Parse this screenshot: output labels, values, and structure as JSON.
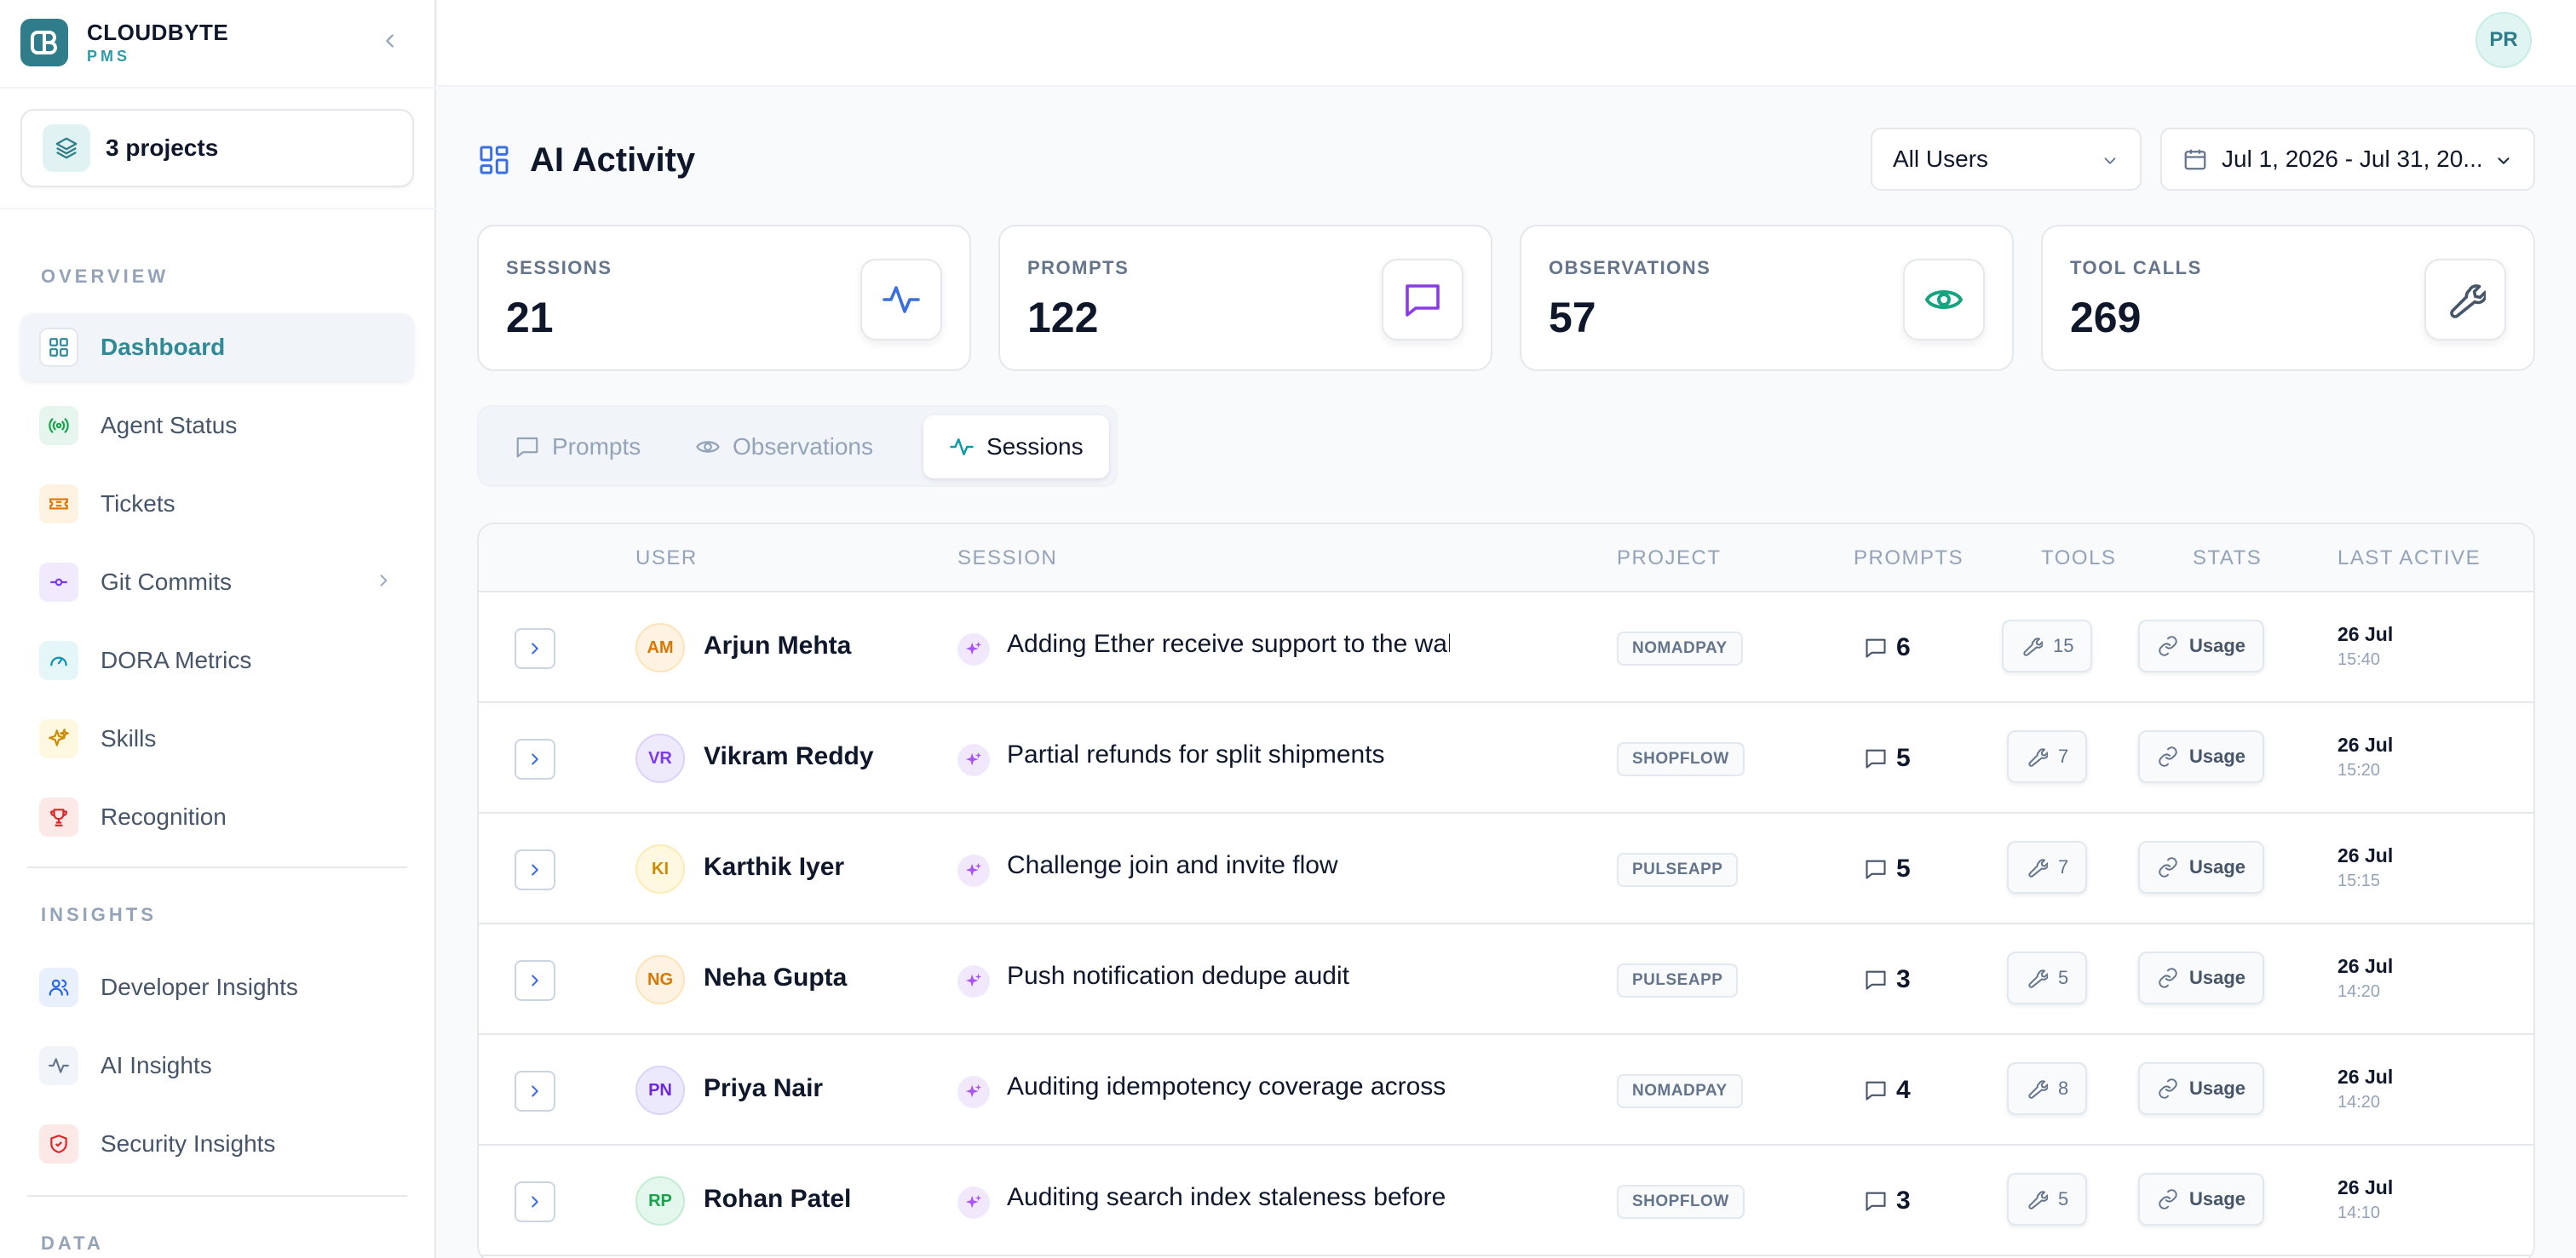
{
  "brand": {
    "name": "CLOUDBYTE",
    "sub": "PMS"
  },
  "projects": {
    "label": "3 projects"
  },
  "nav": {
    "overview_label": "OVERVIEW",
    "overview_items": [
      {
        "label": "Dashboard",
        "icon": "grid-icon",
        "active": true
      },
      {
        "label": "Agent Status",
        "icon": "broadcast-icon"
      },
      {
        "label": "Tickets",
        "icon": "ticket-icon"
      },
      {
        "label": "Git Commits",
        "icon": "git-commit-icon"
      },
      {
        "label": "DORA Metrics",
        "icon": "gauge-icon"
      },
      {
        "label": "Skills",
        "icon": "sparkles-icon"
      },
      {
        "label": "Recognition",
        "icon": "trophy-icon"
      }
    ],
    "insights_label": "INSIGHTS",
    "insights_items": [
      {
        "label": "Developer Insights",
        "icon": "users-icon"
      },
      {
        "label": "AI Insights",
        "icon": "activity-icon"
      },
      {
        "label": "Security Insights",
        "icon": "shield-icon"
      }
    ],
    "data_label": "DATA"
  },
  "user": {
    "initials": "PR"
  },
  "header": {
    "title": "AI Activity",
    "users_filter": "All Users",
    "date_range": "Jul 1, 2026 - Jul 31, 20..."
  },
  "stats": [
    {
      "label": "SESSIONS",
      "value": "21",
      "icon": "activity-icon",
      "color": "#3b6fe0"
    },
    {
      "label": "PROMPTS",
      "value": "122",
      "icon": "message-square-icon",
      "color": "#8b3ce0"
    },
    {
      "label": "OBSERVATIONS",
      "value": "57",
      "icon": "eye-icon",
      "color": "#16a37f"
    },
    {
      "label": "TOOL CALLS",
      "value": "269",
      "icon": "wrench-icon",
      "color": "#475569"
    }
  ],
  "tabs": [
    {
      "label": "Prompts",
      "icon": "message-square-icon"
    },
    {
      "label": "Observations",
      "icon": "eye-icon"
    },
    {
      "label": "Sessions",
      "icon": "activity-icon",
      "active": true
    }
  ],
  "table": {
    "headers": {
      "user": "USER",
      "session": "SESSION",
      "project": "PROJECT",
      "prompts": "PROMPTS",
      "tools": "TOOLS",
      "stats": "STATS",
      "last_active": "LAST ACTIVE"
    },
    "rows": [
      {
        "initials": "AM",
        "name": "Arjun Mehta",
        "session": "Adding Ether receive support to the walle",
        "project": "NOMADPAY",
        "prompts": "6",
        "tools": "15",
        "stats": "Usage",
        "date": "26 Jul",
        "time": "15:40",
        "avatar_bg": "#fef3e2",
        "avatar_fg": "#d97706"
      },
      {
        "initials": "VR",
        "name": "Vikram Reddy",
        "session": "Partial refunds for split shipments",
        "project": "SHOPFLOW",
        "prompts": "5",
        "tools": "7",
        "stats": "Usage",
        "date": "26 Jul",
        "time": "15:20",
        "avatar_bg": "#efe9fc",
        "avatar_fg": "#7c3aed"
      },
      {
        "initials": "KI",
        "name": "Karthik Iyer",
        "session": "Challenge join and invite flow",
        "project": "PULSEAPP",
        "prompts": "5",
        "tools": "7",
        "stats": "Usage",
        "date": "26 Jul",
        "time": "15:15",
        "avatar_bg": "#fef8e1",
        "avatar_fg": "#ca8a04"
      },
      {
        "initials": "NG",
        "name": "Neha Gupta",
        "session": "Push notification dedupe audit",
        "project": "PULSEAPP",
        "prompts": "3",
        "tools": "5",
        "stats": "Usage",
        "date": "26 Jul",
        "time": "14:20",
        "avatar_bg": "#fef3e2",
        "avatar_fg": "#d97706"
      },
      {
        "initials": "PN",
        "name": "Priya Nair",
        "session": "Auditing idempotency coverage across th",
        "project": "NOMADPAY",
        "prompts": "4",
        "tools": "8",
        "stats": "Usage",
        "date": "26 Jul",
        "time": "14:20",
        "avatar_bg": "#ece9fc",
        "avatar_fg": "#6d28d9"
      },
      {
        "initials": "RP",
        "name": "Rohan Patel",
        "session": "Auditing search index staleness before th",
        "project": "SHOPFLOW",
        "prompts": "3",
        "tools": "5",
        "stats": "Usage",
        "date": "26 Jul",
        "time": "14:10",
        "avatar_bg": "#e3f7ec",
        "avatar_fg": "#16a34a"
      }
    ]
  }
}
